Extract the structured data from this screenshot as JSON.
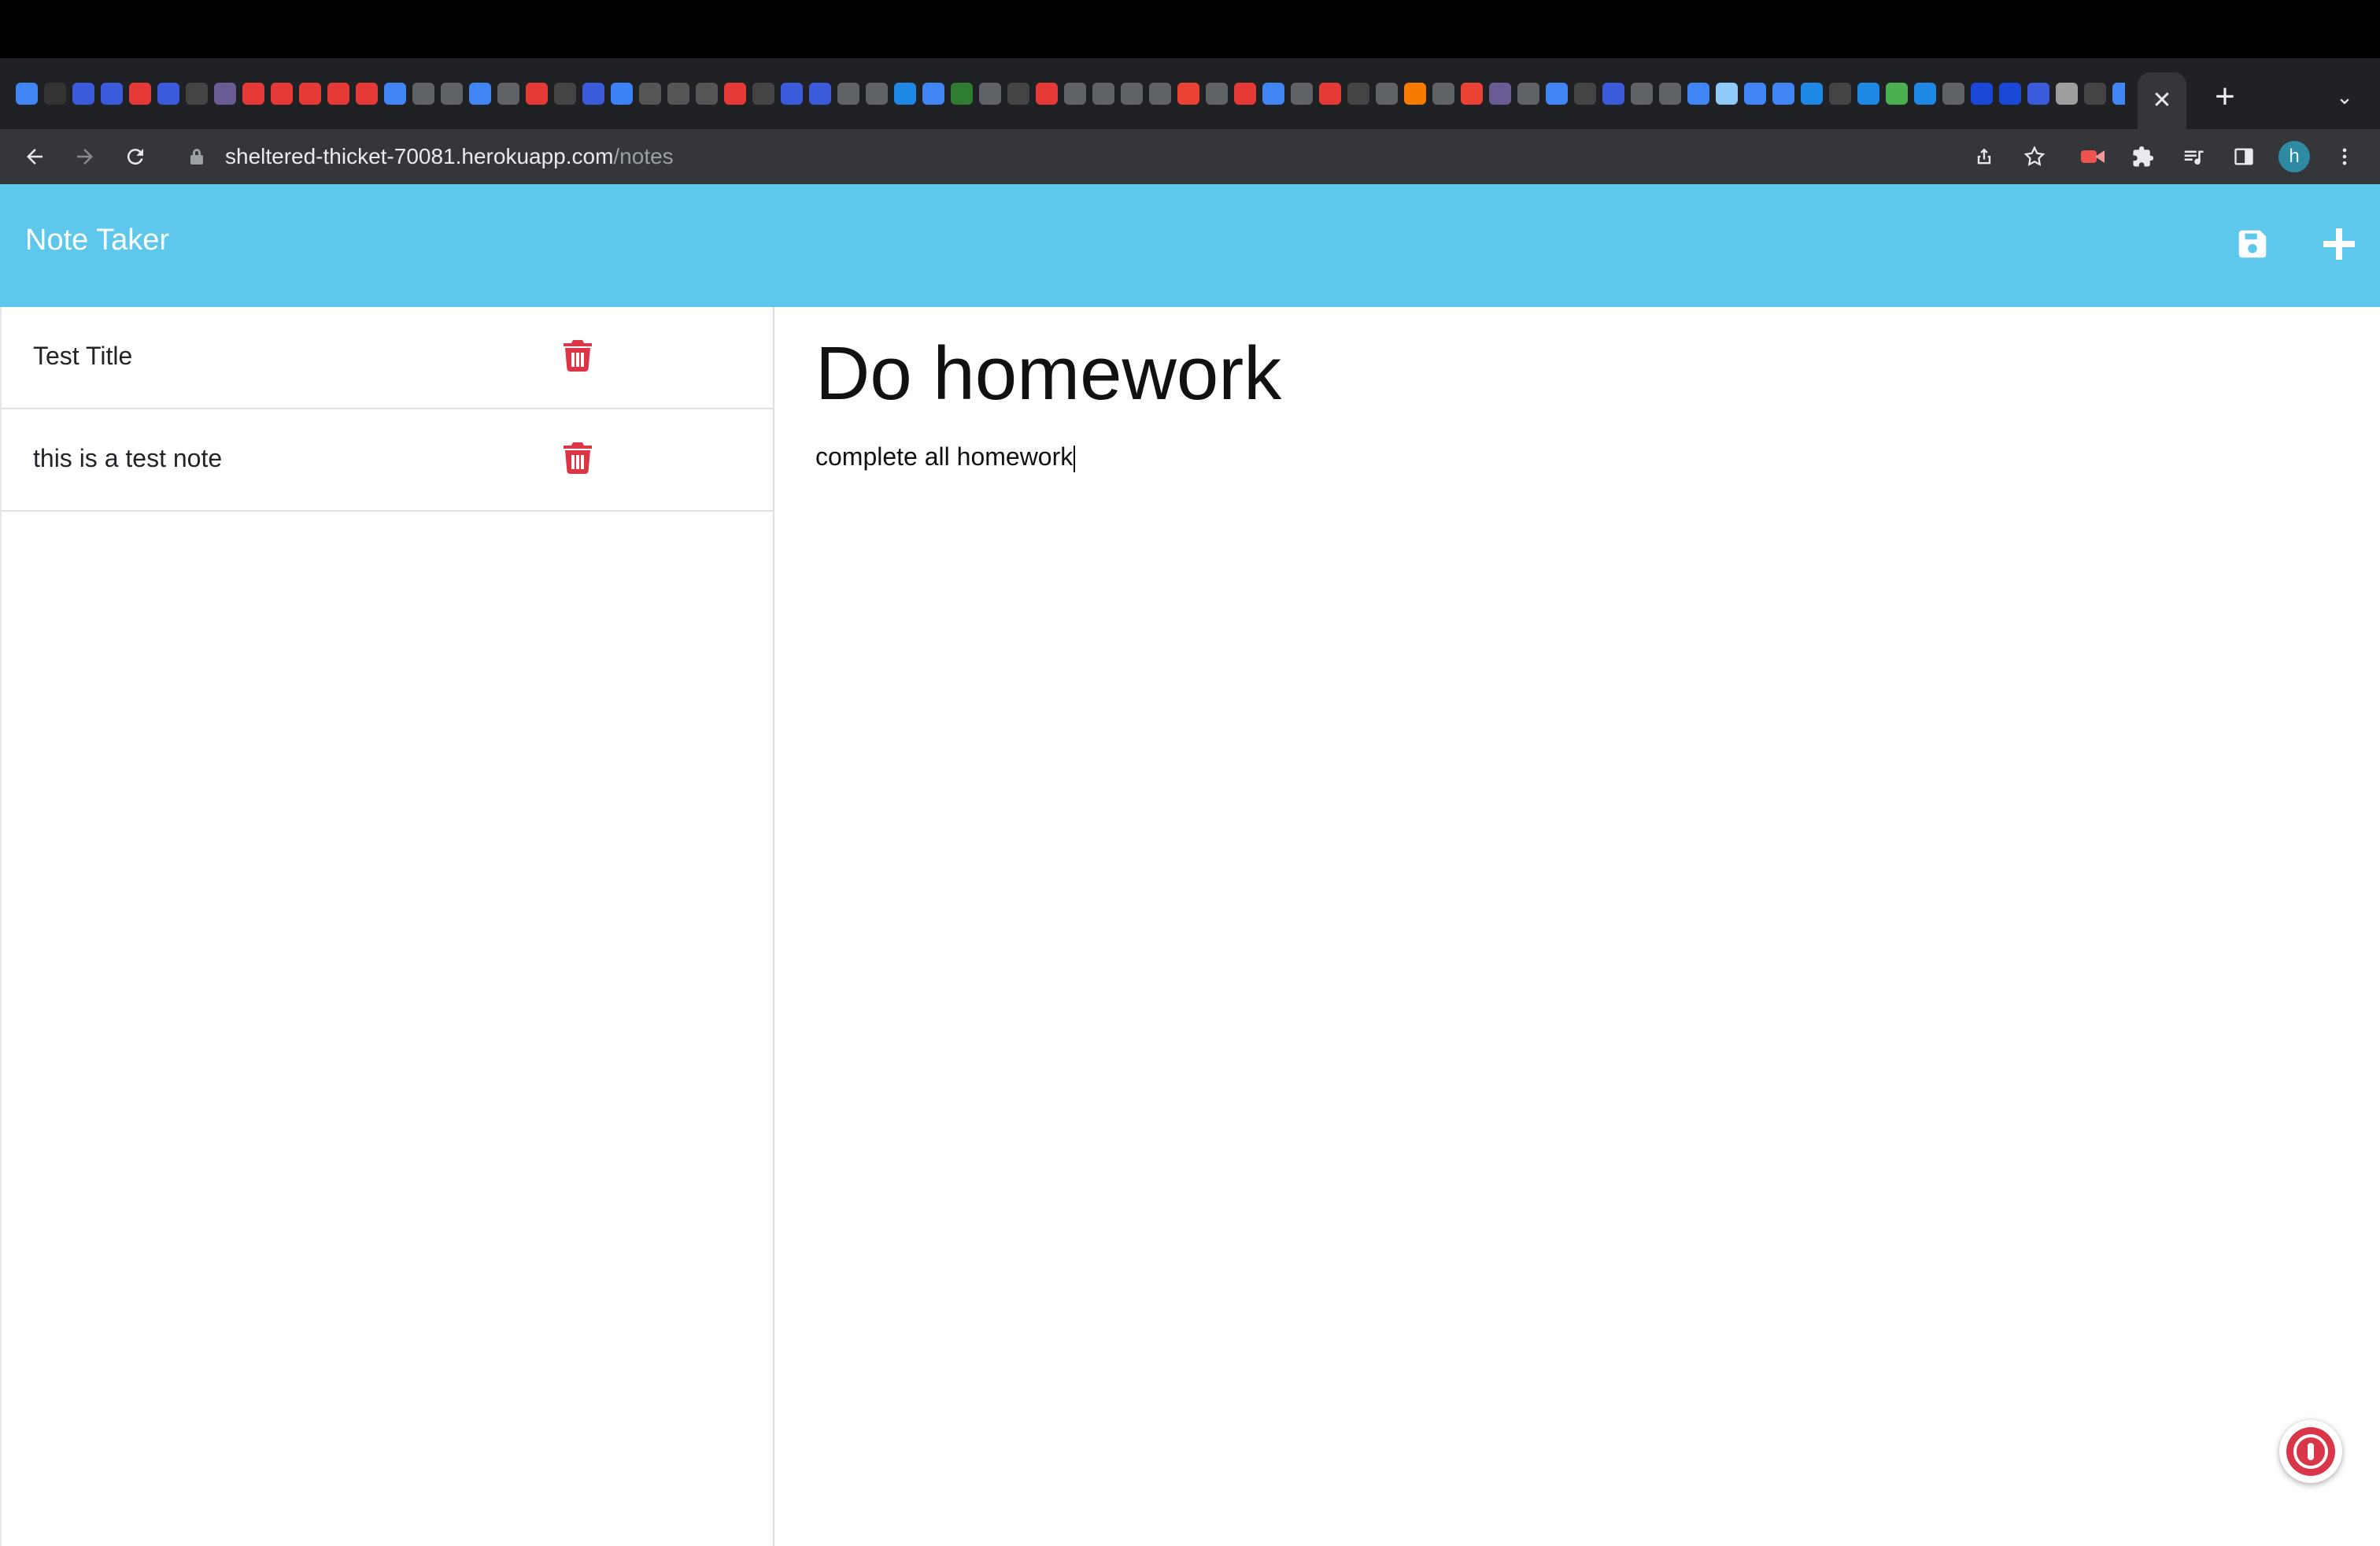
{
  "browser": {
    "tab_close_glyph": "✕",
    "new_tab_glyph": "+",
    "tab_search_glyph": "⌄",
    "url_host": "sheltered-thicket-70081.herokuapp.com",
    "url_path": "/notes",
    "profile_initial": "h",
    "favicon_colors": [
      "#4285f4",
      "#333333",
      "#3b5bdb",
      "#3b5bdb",
      "#e53935",
      "#3b5bdb",
      "#444444",
      "#6b5b95",
      "#e53935",
      "#e53935",
      "#e53935",
      "#e53935",
      "#e53935",
      "#4285f4",
      "#5f6368",
      "#5f6368",
      "#4285f4",
      "#5f6368",
      "#e53935",
      "#444444",
      "#3b5bdb",
      "#3b82f6",
      "#555555",
      "#555555",
      "#555555",
      "#e53935",
      "#444444",
      "#3b5bdb",
      "#3b5bdb",
      "#5f6368",
      "#5f6368",
      "#1e88e5",
      "#4285f4",
      "#2e7d32",
      "#5f6368",
      "#444444",
      "#e53935",
      "#5f6368",
      "#5f6368",
      "#5f6368",
      "#5f6368",
      "#ea4335",
      "#5f6368",
      "#e53935",
      "#4285f4",
      "#5f6368",
      "#e53935",
      "#444444",
      "#5f6368",
      "#f57c00",
      "#5f6368",
      "#ea4335",
      "#6b5b95",
      "#5f6368",
      "#4285f4",
      "#444444",
      "#3b5bdb",
      "#5f6368",
      "#5f6368",
      "#4285f4",
      "#90caf9",
      "#4285f4",
      "#4285f4",
      "#1e88e5",
      "#444444",
      "#1e88e5",
      "#4caf50",
      "#1e88e5",
      "#5f6368",
      "#1a47d6",
      "#1a47d6",
      "#3b5bdb",
      "#9e9e9e",
      "#444444",
      "#4285f4",
      "#1a47d6"
    ]
  },
  "app": {
    "brand": "Note Taker",
    "accent_color": "#5ec8ec",
    "delete_color": "#dc3545",
    "notes": [
      {
        "title": "Test Title"
      },
      {
        "title": "this is a test note"
      }
    ],
    "active_note": {
      "title": "Do homework",
      "text": "complete all homework"
    }
  }
}
